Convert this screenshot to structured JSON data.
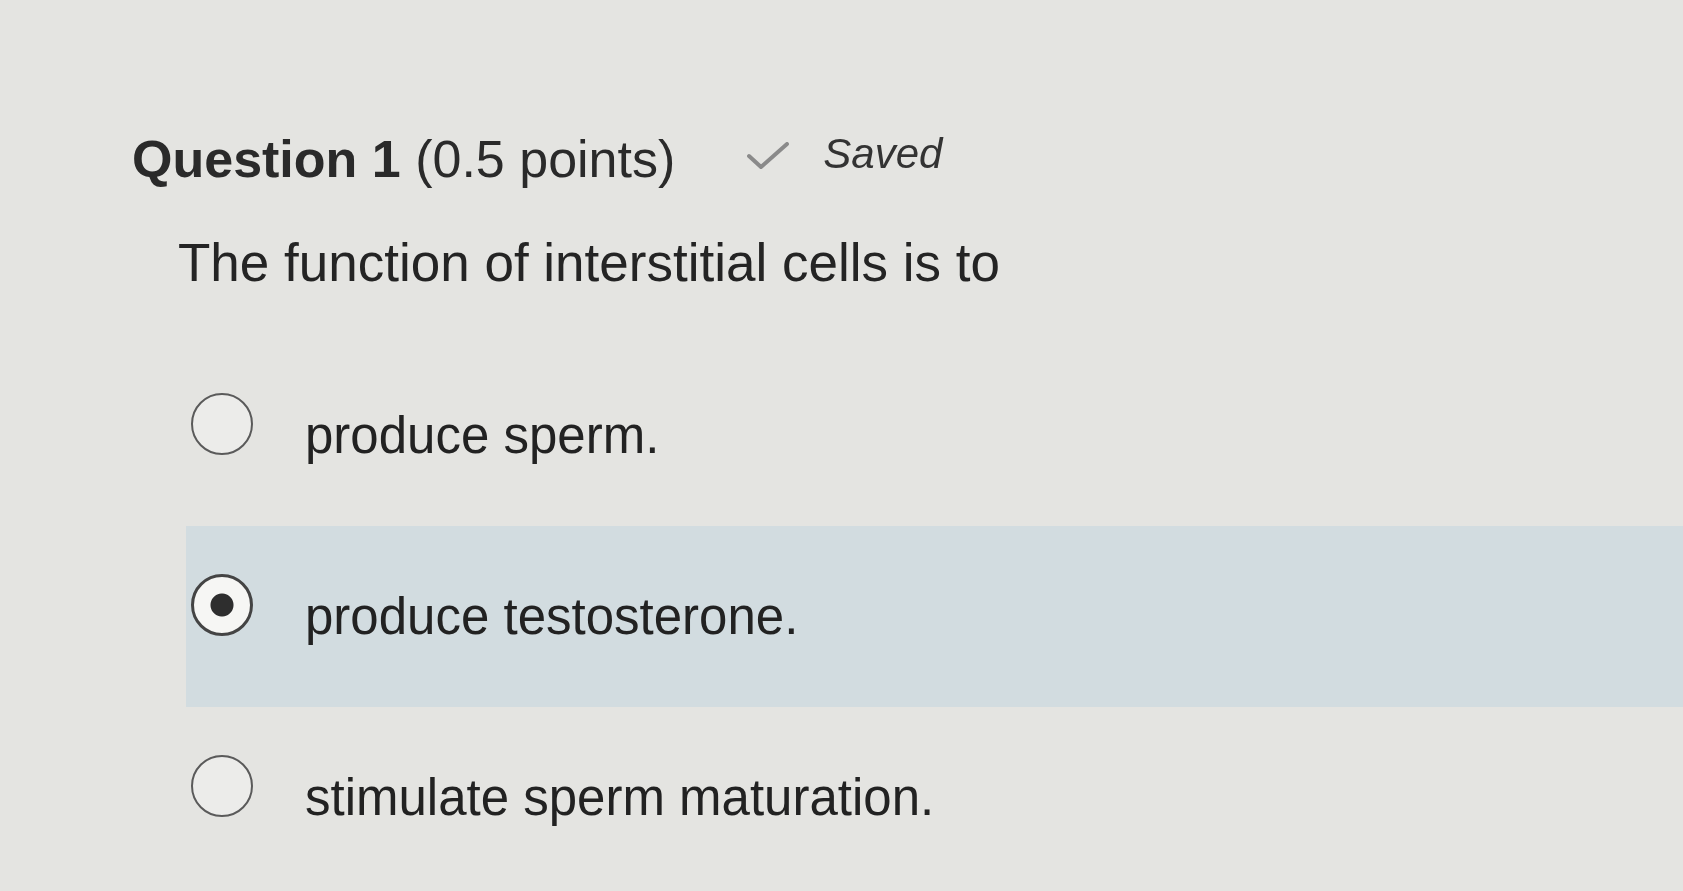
{
  "question": {
    "title": "**Question 1** (0.5 points)",
    "save_status": "Saved",
    "prompt": "The function of interstitial cells is to",
    "options": [
      {
        "label": "produce sperm.",
        "selected": false
      },
      {
        "label": "produce testosterone.",
        "selected": true
      },
      {
        "label": "stimulate sperm maturation.",
        "selected": false
      }
    ]
  }
}
